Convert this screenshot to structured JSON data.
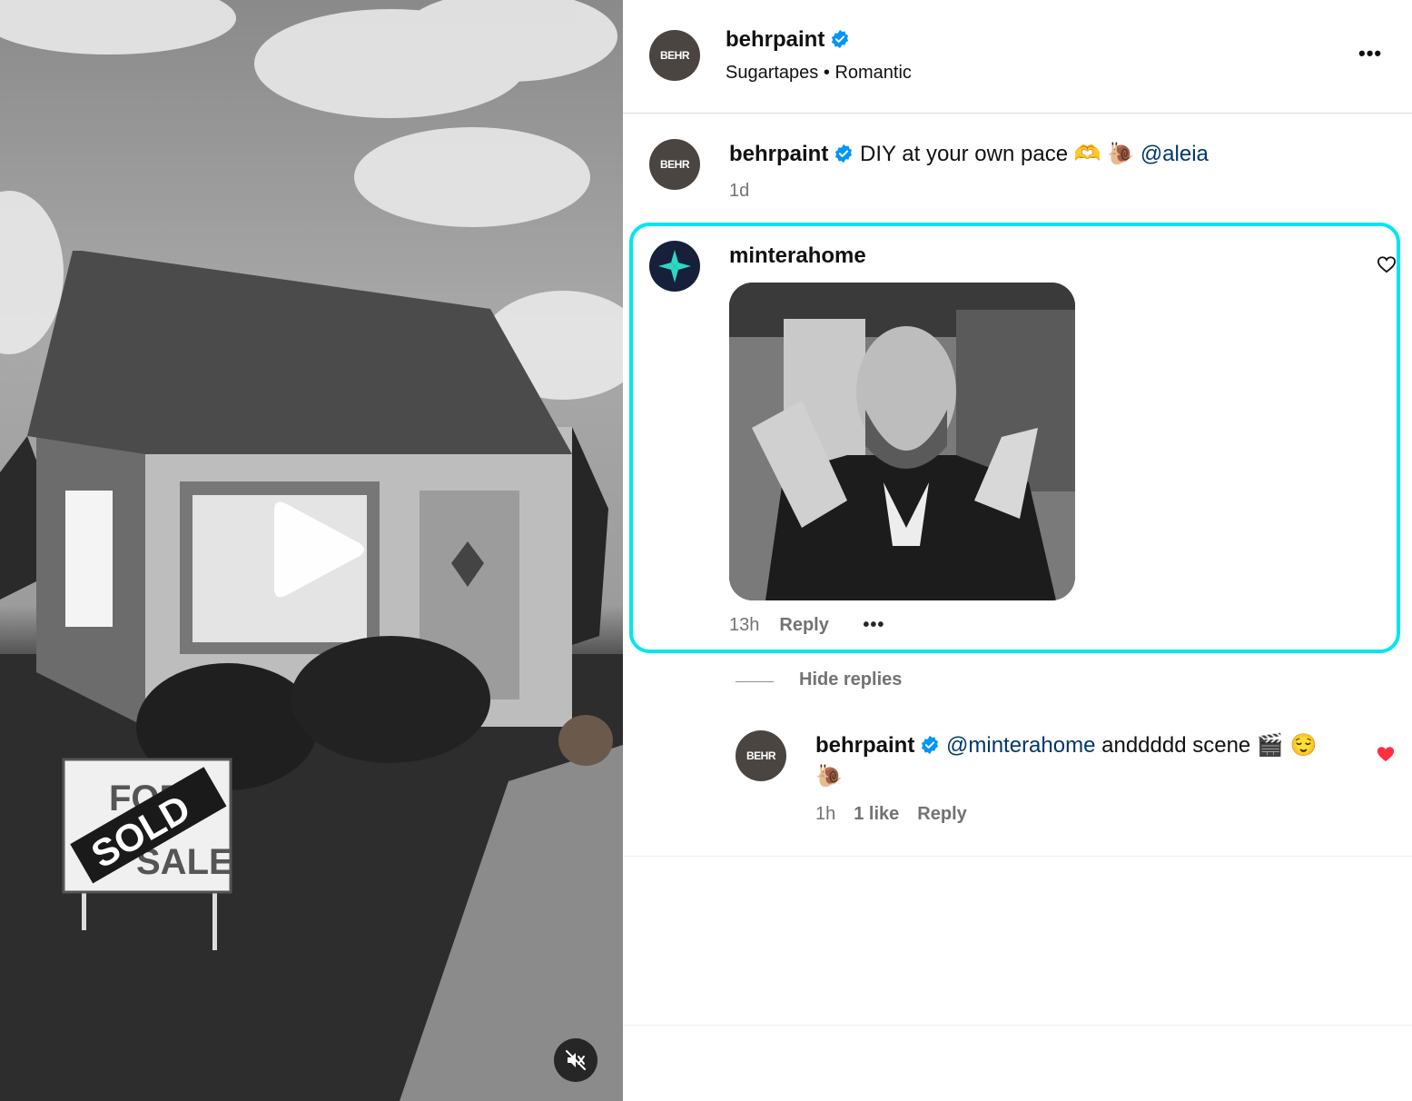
{
  "post": {
    "author": "behrpaint",
    "avatar_text": "BEHR",
    "audio_artist": "Sugartapes",
    "audio_separator": "•",
    "audio_track": "Romantic",
    "caption_text": "DIY at your own pace 🫶 🐌",
    "caption_mention": "@aleia",
    "caption_time": "1d"
  },
  "media": {
    "sign_top": "FOR",
    "sign_bottom": "SALE",
    "sign_banner": "SOLD"
  },
  "comments": [
    {
      "author": "minterahome",
      "time": "13h",
      "reply_label": "Reply",
      "has_gif": true,
      "liked": false,
      "highlighted": true
    }
  ],
  "replies_toggle": "Hide replies",
  "replies": [
    {
      "author": "behrpaint",
      "avatar_text": "BEHR",
      "mention": "@minterahome",
      "text": " anddddd scene 🎬 😌",
      "text_line2": "🐌",
      "time": "1h",
      "likes": "1 like",
      "reply_label": "Reply",
      "liked": true
    }
  ],
  "colors": {
    "highlight": "#00e5f4",
    "verified": "#0095f6",
    "mention": "#00376b",
    "like_red": "#ff3040"
  }
}
